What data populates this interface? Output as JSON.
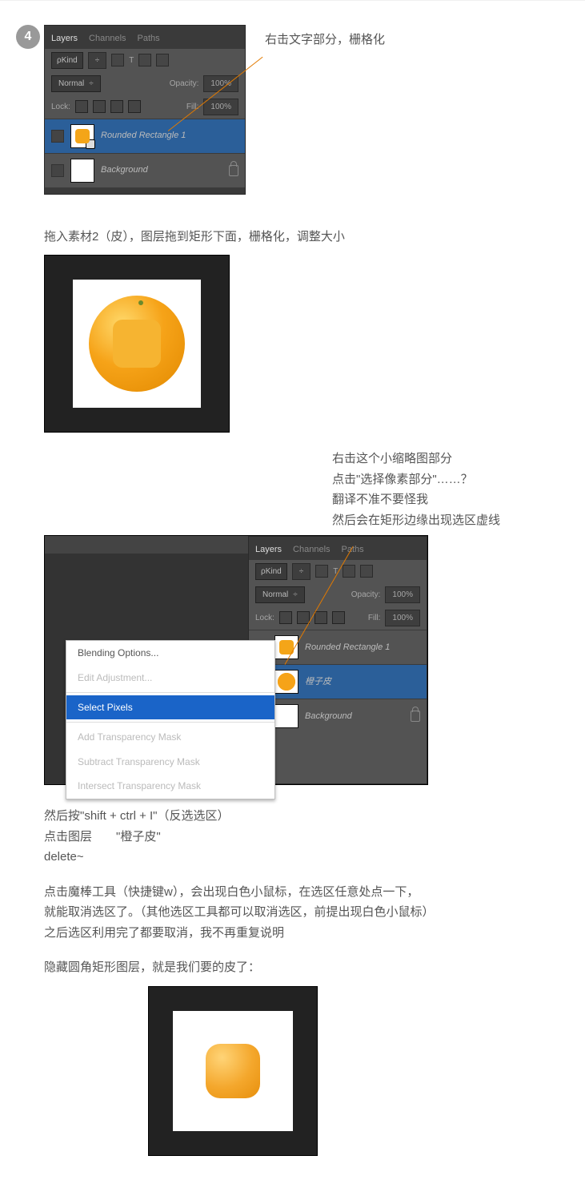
{
  "step_number": "4",
  "annotation1": "右击文字部分，栅格化",
  "panel1": {
    "tabs": [
      "Layers",
      "Channels",
      "Paths"
    ],
    "kind": "ρKind",
    "blend_mode": "Normal",
    "opacity_label": "Opacity:",
    "opacity_value": "100%",
    "lock_label": "Lock:",
    "fill_label": "Fill:",
    "fill_value": "100%",
    "layer_shape": "Rounded Rectangle 1",
    "layer_bg": "Background"
  },
  "instruction1": "拖入素材2（皮），图层拖到矩形下面，栅格化，调整大小",
  "annotation2_lines": [
    "右击这个小缩略图部分",
    "点击\"选择像素部分\"……？",
    "翻译不准不要怪我",
    "然后会在矩形边缘出现选区虚线"
  ],
  "panel2": {
    "tabs": [
      "Layers",
      "Channels",
      "Paths"
    ],
    "kind": "ρKind",
    "blend_mode": "Normal",
    "opacity_label": "Opacity:",
    "opacity_value": "100%",
    "lock_label": "Lock:",
    "fill_label": "Fill:",
    "fill_value": "100%",
    "layer_shape": "Rounded Rectangle 1",
    "layer_orange": "橙子皮",
    "layer_bg": "Background"
  },
  "context_menu": {
    "blending": "Blending Options...",
    "edit_adj": "Edit Adjustment...",
    "select_pixels": "Select Pixels",
    "add_mask": "Add Transparency Mask",
    "sub_mask": "Subtract Transparency Mask",
    "int_mask": "Intersect Transparency Mask"
  },
  "instruction2_line1": "然后按\"shift + ctrl + I\"（反选选区）",
  "instruction2_line2": "点击图层　　\"橙子皮\"",
  "instruction2_line3": "delete~",
  "instruction3_line1": "点击魔棒工具（快捷键w），会出现白色小鼠标，在选区任意处点一下，",
  "instruction3_line2": "就能取消选区了。（其他选区工具都可以取消选区，前提出现白色小鼠标）",
  "instruction3_line3": "之后选区利用完了都要取消，我不再重复说明",
  "instruction4": "隐藏圆角矩形图层，就是我们要的皮了："
}
